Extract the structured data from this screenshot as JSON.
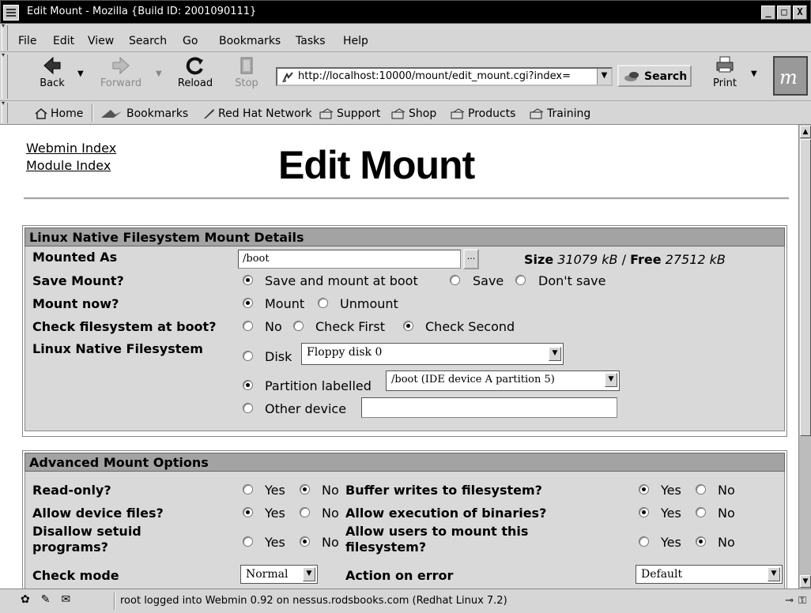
{
  "window": {
    "title": "Edit Mount - Mozilla {Build ID: 2001090111}",
    "buttons": [
      "_",
      "□",
      "X"
    ]
  },
  "menu": [
    "File",
    "Edit",
    "View",
    "Search",
    "Go",
    "Bookmarks",
    "Tasks",
    "Help"
  ],
  "nav": {
    "back": "Back",
    "forward": "Forward",
    "reload": "Reload",
    "stop": "Stop",
    "url": "http://localhost:10000/mount/edit_mount.cgi?index=",
    "search": "Search",
    "print": "Print"
  },
  "personal_bar": [
    "Home",
    "Bookmarks",
    "Red Hat Network",
    "Support",
    "Shop",
    "Products",
    "Training"
  ],
  "page": {
    "links": [
      "Webmin Index",
      "Module Index"
    ],
    "title": "Edit Mount"
  },
  "mount_details": {
    "header": "Linux Native Filesystem Mount Details",
    "mounted_as_label": "Mounted As",
    "mounted_as_value": "/boot",
    "browse_label": "...",
    "size_label": "Size",
    "size_value": "31079 kB",
    "slash": "/",
    "free_label": "Free",
    "free_value": "27512 kB",
    "save_mount_label": "Save Mount?",
    "save_opts": [
      "Save and mount at boot",
      "Save",
      "Don't save"
    ],
    "save_selected": 0,
    "mount_now_label": "Mount now?",
    "mount_opts": [
      "Mount",
      "Unmount"
    ],
    "mount_selected": 0,
    "check_label": "Check filesystem at boot?",
    "check_opts": [
      "No",
      "Check First",
      "Check Second"
    ],
    "check_selected": 2,
    "fs_label": "Linux Native Filesystem",
    "disk_label": "Disk",
    "disk_value": "Floppy disk 0",
    "partition_label": "Partition labelled",
    "partition_value": "/boot (IDE device A partition 5)",
    "other_label": "Other device",
    "other_value": "",
    "device_selected": 1
  },
  "advanced": {
    "header": "Advanced Mount Options",
    "yes": "Yes",
    "no": "No",
    "left_rows": [
      {
        "label": "Read-only?",
        "selected": "no"
      },
      {
        "label": "Allow device files?",
        "selected": "yes"
      },
      {
        "label": "Disallow setuid programs?",
        "selected": "no"
      }
    ],
    "right_rows": [
      {
        "label": "Buffer writes to filesystem?",
        "selected": "yes"
      },
      {
        "label": "Allow execution of binaries?",
        "selected": "yes"
      },
      {
        "label": "Allow users to mount this filesystem?",
        "selected": "no"
      }
    ],
    "check_mode_label": "Check mode",
    "check_mode_value": "Normal",
    "action_error_label": "Action on error",
    "action_error_value": "Default"
  },
  "status": {
    "text": "root logged into Webmin 0.92 on nessus.rodsbooks.com (Redhat Linux 7.2)"
  }
}
